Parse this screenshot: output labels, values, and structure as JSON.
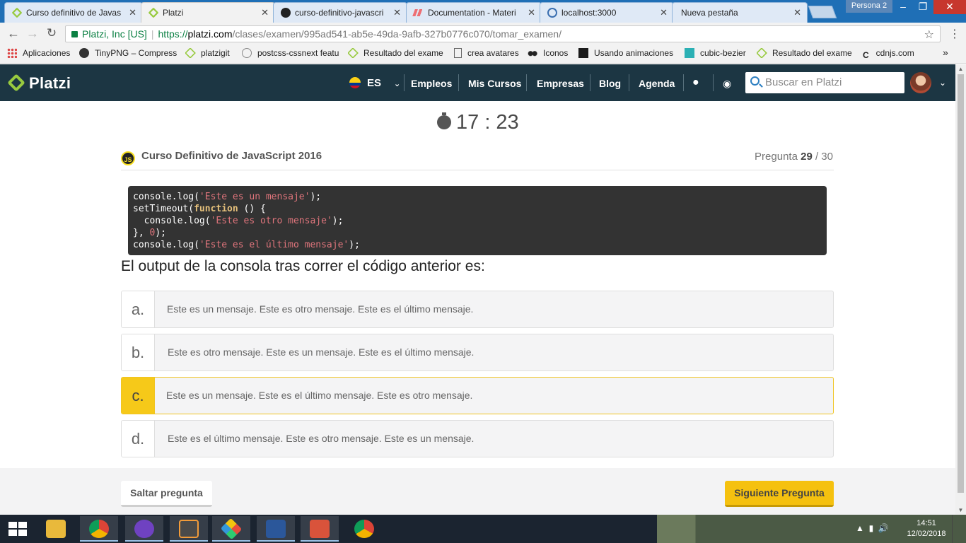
{
  "browser": {
    "tabs": [
      {
        "label": "Curso definitivo de Javas",
        "icon": "platzi-icon"
      },
      {
        "label": "Platzi",
        "icon": "platzi-icon"
      },
      {
        "label": "curso-definitivo-javascri",
        "icon": "github-icon"
      },
      {
        "label": "Documentation - Materi",
        "icon": "materialize-icon"
      },
      {
        "label": "localhost:3000",
        "icon": "page-icon"
      },
      {
        "label": "Nueva pestaña",
        "icon": "none"
      }
    ],
    "persona": "Persona 2",
    "security_label": "Platzi, Inc [US]",
    "url_scheme": "https://",
    "url_host": "platzi.com",
    "url_path": "/clases/examen/995ad541-ab5e-49da-9afb-327b0776c070/tomar_examen/",
    "bookmarks": [
      {
        "label": "Aplicaciones"
      },
      {
        "label": "TinyPNG – Compress"
      },
      {
        "label": "platzigit"
      },
      {
        "label": "postcss-cssnext featu"
      },
      {
        "label": "Resultado del exame"
      },
      {
        "label": "crea avatares"
      },
      {
        "label": "Iconos"
      },
      {
        "label": "Usando animaciones"
      },
      {
        "label": "cubic-bezier"
      },
      {
        "label": "Resultado del exame"
      },
      {
        "label": "cdnjs.com"
      }
    ],
    "bookmarks_more": "»"
  },
  "header": {
    "logo": "Platzi",
    "language": "ES",
    "nav": [
      "Empleos",
      "Mis Cursos",
      "Empresas",
      "Blog",
      "Agenda"
    ],
    "search_placeholder": "Buscar en Platzi"
  },
  "exam": {
    "timer": "17 : 23",
    "course_badge": "JS",
    "course": "Curso Definitivo de JavaScript 2016",
    "question_label": "Pregunta",
    "question_current": "29",
    "question_total": "/ 30",
    "code_lines": [
      [
        {
          "t": "console.log(",
          "c": ""
        },
        {
          "t": "'Este es un mensaje'",
          "c": "str"
        },
        {
          "t": ");",
          "c": ""
        }
      ],
      [
        {
          "t": "setTimeout(",
          "c": ""
        },
        {
          "t": "function",
          "c": "kw"
        },
        {
          "t": " () {",
          "c": ""
        }
      ],
      [
        {
          "t": "  console.log(",
          "c": ""
        },
        {
          "t": "'Este es otro mensaje'",
          "c": "str"
        },
        {
          "t": ");",
          "c": ""
        }
      ],
      [
        {
          "t": "}, ",
          "c": ""
        },
        {
          "t": "0",
          "c": "num"
        },
        {
          "t": ");",
          "c": ""
        }
      ],
      [
        {
          "t": "console.log(",
          "c": ""
        },
        {
          "t": "'Este es el último mensaje'",
          "c": "str"
        },
        {
          "t": ");",
          "c": ""
        }
      ]
    ],
    "question": "El output de la consola tras correr el código anterior es:",
    "options": [
      {
        "letter": "a.",
        "text": "Este es un mensaje. Este es otro mensaje. Este es el último mensaje.",
        "selected": false
      },
      {
        "letter": "b.",
        "text": "Este es otro mensaje. Este es un mensaje. Este es el último mensaje.",
        "selected": false
      },
      {
        "letter": "c.",
        "text": "Este es un mensaje. Este es el último mensaje. Este es otro mensaje.",
        "selected": true
      },
      {
        "letter": "d.",
        "text": "Este es el último mensaje. Este es otro mensaje. Este es un mensaje.",
        "selected": false
      }
    ],
    "skip_label": "Saltar pregunta",
    "next_label": "Siguiente Pregunta"
  },
  "colors": {
    "header_bg": "#1c3643",
    "brand_green": "#98ca3f",
    "accent_yellow": "#f6c919"
  },
  "taskbar": {
    "apps": [
      "file-explorer",
      "chrome",
      "github-desktop",
      "sublime-text",
      "git-gui",
      "word",
      "teams",
      "chrome"
    ],
    "time": "14:51",
    "date": "12/02/2018"
  }
}
